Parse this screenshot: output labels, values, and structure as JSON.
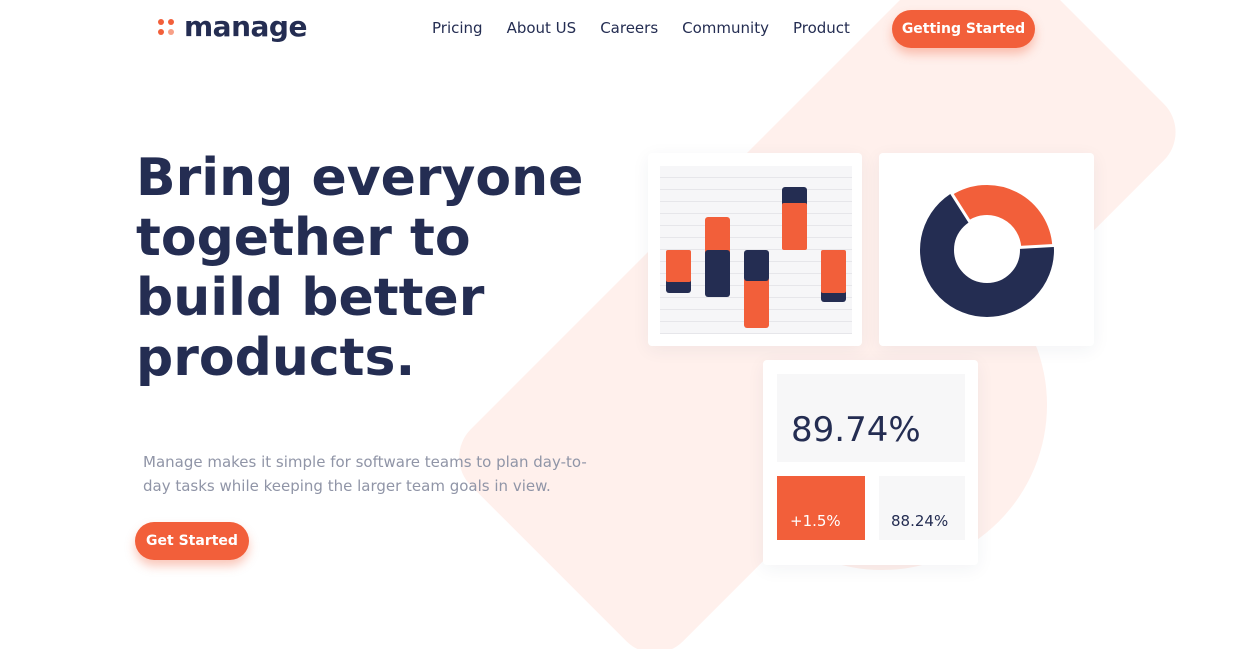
{
  "brand": {
    "name": "manage"
  },
  "nav": {
    "items": [
      "Pricing",
      "About US",
      "Careers",
      "Community",
      "Product"
    ],
    "cta_label": "Getting Started"
  },
  "hero": {
    "title": "Bring everyone together to build better products.",
    "description": "Manage makes it simple for software teams to plan day-to-day tasks while keeping the larger team goals in view.",
    "cta_label": "Get Started"
  },
  "stats": {
    "main": "89.74%",
    "change": "+1.5%",
    "secondary": "88.24%"
  },
  "colors": {
    "accent": "#f25f3a",
    "navy": "#242d52",
    "background_shape": "#fff0ec"
  },
  "icons": {
    "logo": "four-dot-logo-icon"
  }
}
